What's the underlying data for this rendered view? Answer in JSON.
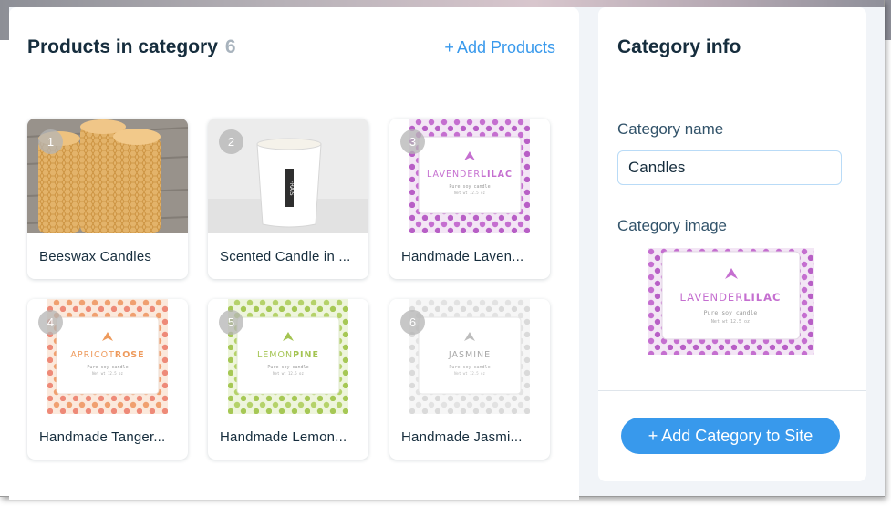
{
  "products_panel": {
    "title": "Products in category",
    "count": "6",
    "add_products_plus": "+",
    "add_products_label": "Add Products"
  },
  "products": [
    {
      "number": "1",
      "name": "Beeswax Candles",
      "image": "beeswax-candles"
    },
    {
      "number": "2",
      "name": "Scented Candle in ...",
      "image": "white-scented-candle"
    },
    {
      "number": "3",
      "name": "Handmade Laven...",
      "image": "lavender-lilac-candle"
    },
    {
      "number": "4",
      "name": "Handmade Tanger...",
      "image": "apricot-rose-candle"
    },
    {
      "number": "5",
      "name": "Handmade Lemon...",
      "image": "lemon-pine-candle"
    },
    {
      "number": "6",
      "name": "Handmade Jasmi...",
      "image": "jasmine-candle"
    }
  ],
  "candle_labels": {
    "lavender": [
      "LAVENDER",
      "LILAC"
    ],
    "apricot": [
      "APRICOT",
      "ROSE"
    ],
    "lemon": [
      "LEMON",
      "PINE"
    ],
    "jasmine": [
      "JASMINE",
      ""
    ],
    "subline": "Pure soy candle",
    "weight": "Net wt 12.5 oz",
    "frais": "FRAIS"
  },
  "colors": {
    "accent": "#3899ec",
    "lavender": "#c56fd0",
    "apricot": "#f0a070",
    "lemon": "#b5d26a",
    "jasmine": "#dcdcdc"
  },
  "info_panel": {
    "title": "Category info",
    "name_label": "Category name",
    "name_value": "Candles",
    "image_label": "Category image",
    "add_button": "+ Add Category to Site"
  }
}
